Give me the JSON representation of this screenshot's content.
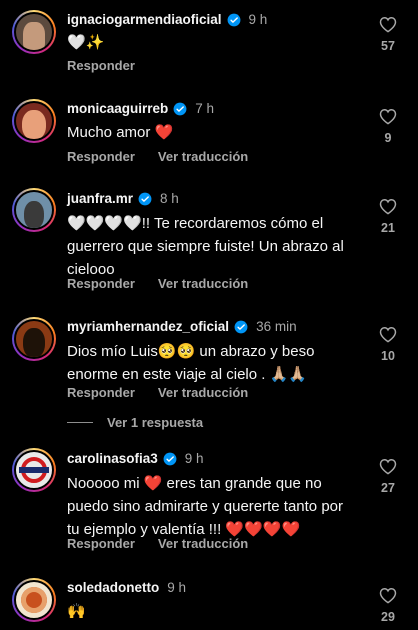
{
  "labels": {
    "reply": "Responder",
    "translate": "Ver traducción"
  },
  "comments": [
    {
      "username": "ignaciogarmendiaoficial",
      "verified": true,
      "time": "9 h",
      "text": "🤍✨",
      "likes": "57",
      "show_translate": false
    },
    {
      "username": "monicaaguirreb",
      "verified": true,
      "time": "7 h",
      "text": "Mucho amor ❤️",
      "likes": "9",
      "show_translate": true
    },
    {
      "username": "juanfra.mr",
      "verified": true,
      "time": "8 h",
      "text": "🤍🤍🤍🤍!! Te recordaremos cómo el guerrero que siempre fuiste! Un abrazo al cielooo",
      "likes": "21",
      "show_translate": true
    },
    {
      "username": "myriamhernandez_oficial",
      "verified": true,
      "time": "36 min",
      "text": "Dios mío Luis🥺🥺 un abrazo y beso enorme en este viaje al cielo . 🙏🏼🙏🏼",
      "likes": "10",
      "show_translate": true,
      "replies_label": "Ver 1 respuesta"
    },
    {
      "username": "carolinasofia3",
      "verified": true,
      "time": "9 h",
      "text": "Nooooo mi ❤️ eres tan grande que no puedo sino admirarte y quererte tanto por tu ejemplo y valentía !!! ❤️❤️❤️❤️",
      "likes": "27",
      "show_translate": true
    },
    {
      "username": "soledadonetto",
      "verified": false,
      "time": "9 h",
      "text": "🙌",
      "likes": "29",
      "show_translate": false
    }
  ],
  "colors": {
    "background": "#000000",
    "text": "#f5f5f5",
    "muted": "#a8a8a8",
    "verified": "#0095f6"
  },
  "icons": {
    "like": "heart-outline-icon",
    "verified": "verified-badge-icon"
  }
}
